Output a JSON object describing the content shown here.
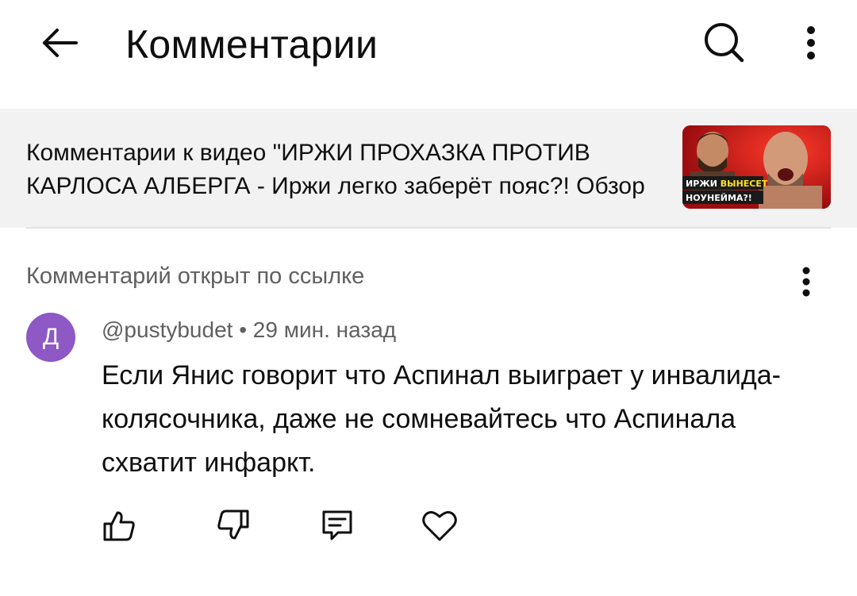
{
  "header": {
    "title": "Комментарии",
    "back_icon": "arrow-left-icon",
    "search_icon": "search-icon",
    "more_icon": "more-vertical-icon"
  },
  "video": {
    "text": "Комментарии к видео \"ИРЖИ ПРОХАЗКА ПРОТИВ КАРЛОСА АЛБЕРГА - Иржи легко заберёт пояс?! Обзор",
    "thumbnail_caption_white_1": "ИРЖИ ",
    "thumbnail_caption_yellow": "ВЫНЕСЕТ",
    "thumbnail_caption_white_2": "НОУНЕЙМА?!"
  },
  "comment_section": {
    "linked_label": "Комментарий открыт по ссылке",
    "more_icon": "more-vertical-icon"
  },
  "comment": {
    "avatar_letter": "Д",
    "avatar_color": "#8e58c5",
    "author": "@pustybudet",
    "separator": " • ",
    "time": "29 мин. назад",
    "text": "Если Янис говорит что Аспинал выиграет у инвалида-колясочника, даже не сомневайтесь что Аспинала схватит инфаркт."
  },
  "actions": [
    {
      "icon": "thumbs-up-icon"
    },
    {
      "icon": "thumbs-down-icon"
    },
    {
      "icon": "reply-icon"
    },
    {
      "icon": "heart-icon"
    }
  ],
  "colors": {
    "banner_bg": "#f2f2f2",
    "secondary_text": "#606060",
    "primary_text": "#0f0f0f"
  }
}
